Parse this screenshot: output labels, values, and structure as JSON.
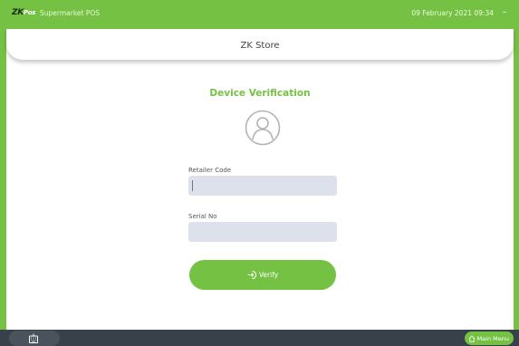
{
  "header": {
    "logo_main": "ZK",
    "logo_sub": "Pos",
    "app_title": "Supermarket POS",
    "datetime": "09 February 2021 09:34",
    "window_control": "–"
  },
  "store": {
    "name": "ZK Store"
  },
  "verification": {
    "title": "Device Verification",
    "avatar_icon": "user-avatar-icon",
    "retailer_code": {
      "label": "Retailer Code",
      "value": "",
      "placeholder": ""
    },
    "serial_no": {
      "label": "Serial No",
      "value": "",
      "placeholder": ""
    },
    "verify_button": {
      "label": "Verify",
      "icon": "login-arrow-icon"
    }
  },
  "footer": {
    "keyboard_icon": "keyboard-icon",
    "main_menu_label": "Main Menu",
    "main_menu_icon": "home-icon"
  },
  "colors": {
    "accent": "#75c144",
    "footer": "#38404a",
    "field_bg": "#dde1ec"
  }
}
